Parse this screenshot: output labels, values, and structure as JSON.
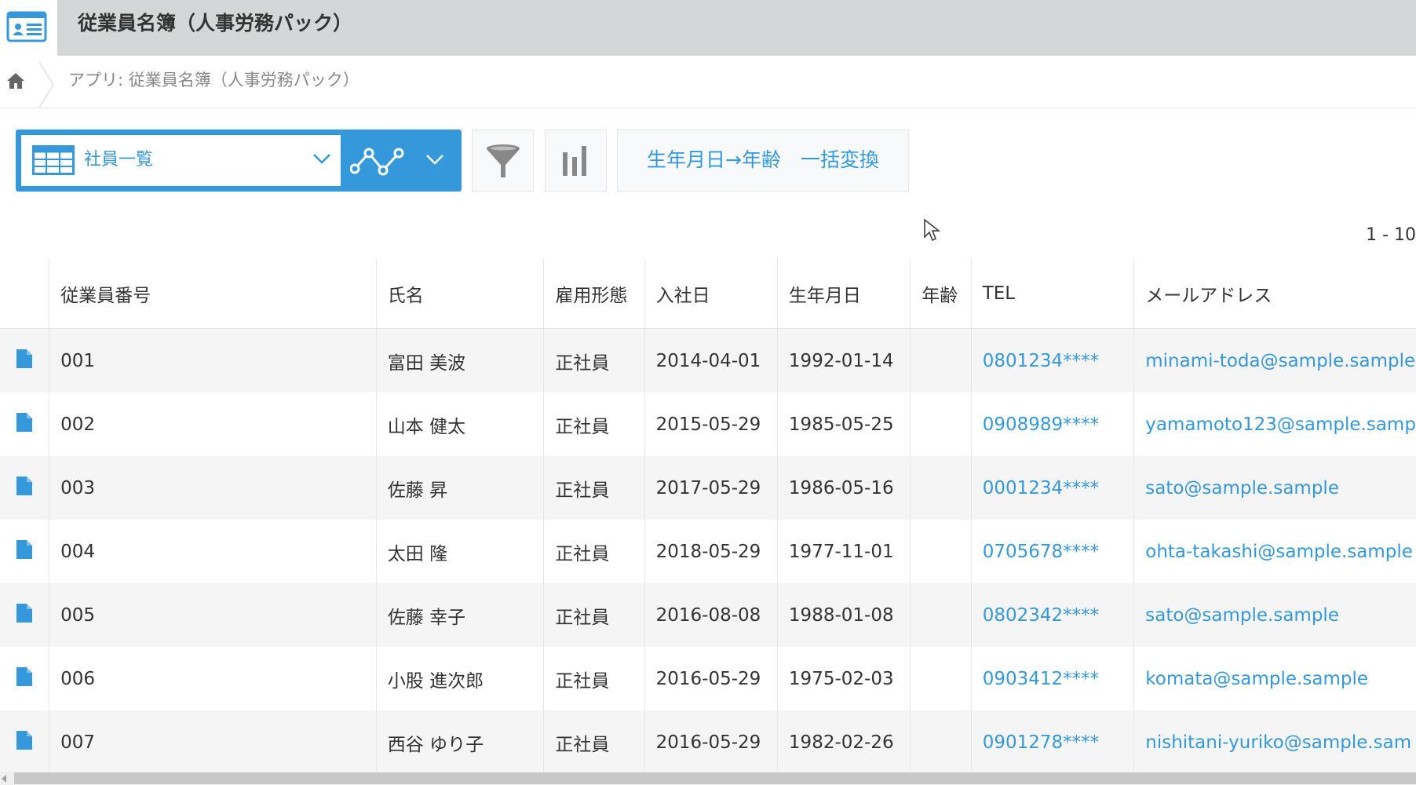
{
  "app": {
    "title": "従業員名簿（人事労務パック）"
  },
  "breadcrumb": {
    "text": "アプリ: 従業員名簿（人事労務パック）"
  },
  "toolbar": {
    "view_label": "社員一覧",
    "convert_label": "生年月日→年齢　一括変換"
  },
  "pagination": {
    "range": "1 - 10"
  },
  "table": {
    "columns": [
      "従業員番号",
      "氏名",
      "雇用形態",
      "入社日",
      "生年月日",
      "年齢",
      "TEL",
      "メールアドレス"
    ],
    "rows": [
      {
        "id": "001",
        "name": "富田 美波",
        "type": "正社員",
        "join": "2014-04-01",
        "birth": "1992-01-14",
        "age": "",
        "tel": "0801234****",
        "email": "minami-toda@sample.sample"
      },
      {
        "id": "002",
        "name": "山本 健太",
        "type": "正社員",
        "join": "2015-05-29",
        "birth": "1985-05-25",
        "age": "",
        "tel": "0908989****",
        "email": "yamamoto123@sample.samp"
      },
      {
        "id": "003",
        "name": "佐藤 昇",
        "type": "正社員",
        "join": "2017-05-29",
        "birth": "1986-05-16",
        "age": "",
        "tel": "0001234****",
        "email": "sato@sample.sample"
      },
      {
        "id": "004",
        "name": "太田 隆",
        "type": "正社員",
        "join": "2018-05-29",
        "birth": "1977-11-01",
        "age": "",
        "tel": "0705678****",
        "email": "ohta-takashi@sample.sample"
      },
      {
        "id": "005",
        "name": "佐藤 幸子",
        "type": "正社員",
        "join": "2016-08-08",
        "birth": "1988-01-08",
        "age": "",
        "tel": "0802342****",
        "email": "sato@sample.sample"
      },
      {
        "id": "006",
        "name": "小股 進次郎",
        "type": "正社員",
        "join": "2016-05-29",
        "birth": "1975-02-03",
        "age": "",
        "tel": "0903412****",
        "email": "komata@sample.sample"
      },
      {
        "id": "007",
        "name": "西谷 ゆり子",
        "type": "正社員",
        "join": "2016-05-29",
        "birth": "1982-02-26",
        "age": "",
        "tel": "0901278****",
        "email": "nishitani-yuriko@sample.sam"
      }
    ]
  },
  "colors": {
    "accent": "#3498db",
    "header_bg": "#d4d7d7",
    "row_alt": "#f5f5f5"
  },
  "icons": [
    "app-card-icon",
    "home-icon",
    "grid-icon",
    "chevron-down-icon",
    "graph-icon",
    "filter-icon",
    "bar-chart-icon",
    "document-icon",
    "cursor-icon"
  ]
}
